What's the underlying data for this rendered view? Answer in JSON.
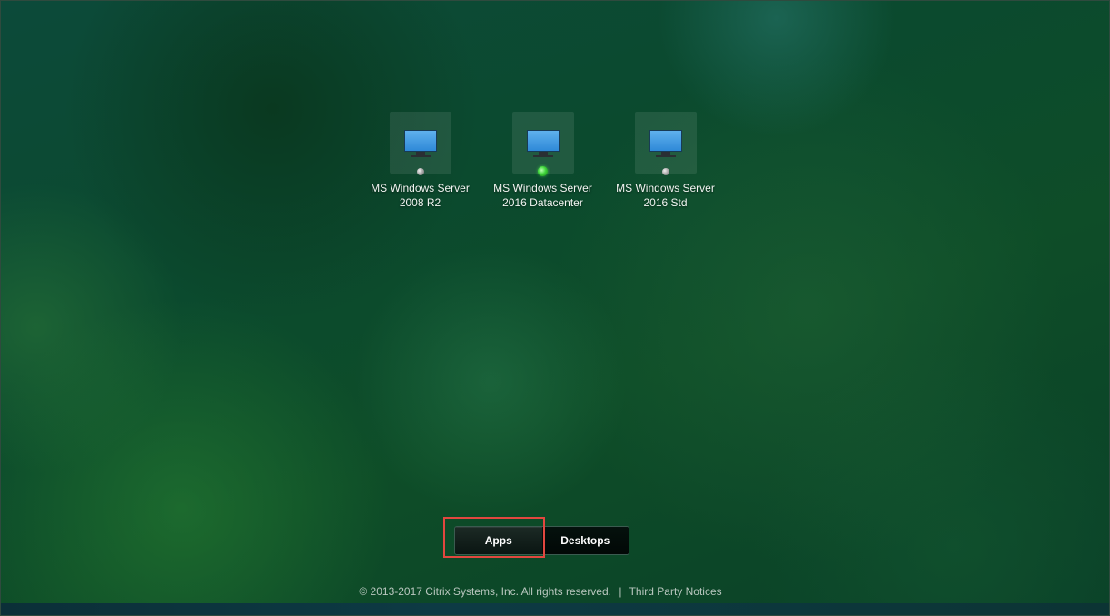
{
  "desktops": [
    {
      "name_line1": "MS Windows Server",
      "name_line2": "2008 R2",
      "status": "offline"
    },
    {
      "name_line1": "MS Windows Server",
      "name_line2": "2016 Datacenter",
      "status": "online"
    },
    {
      "name_line1": "MS Windows Server",
      "name_line2": "2016 Std",
      "status": "offline"
    }
  ],
  "tabs": {
    "apps": "Apps",
    "desktops": "Desktops"
  },
  "footer": {
    "copyright": "© 2013-2017 Citrix Systems, Inc. All rights reserved.",
    "separator": "|",
    "third_party_link": "Third Party Notices"
  },
  "colors": {
    "highlight": "#e2473f",
    "status_online": "#3fd63a",
    "status_offline": "#9a9a9a"
  },
  "icons": {
    "desktop": "monitor-icon",
    "status": "status-indicator"
  }
}
